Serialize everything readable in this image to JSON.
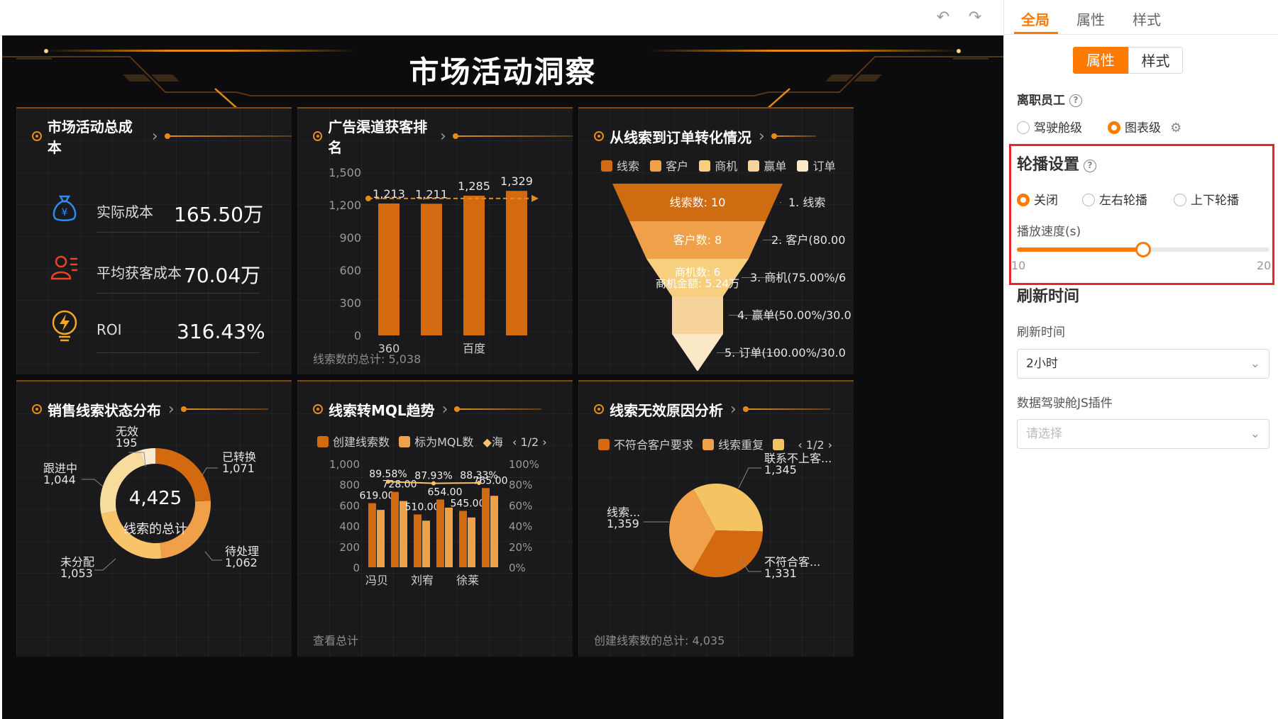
{
  "toolbar": {
    "undo_icon": "undo-icon",
    "redo_icon": "redo-icon"
  },
  "dashboard": {
    "title": "市场活动洞察",
    "panels": {
      "cost": {
        "title": "市场活动总成本",
        "items": [
          {
            "label": "实际成本",
            "value": "165.50万",
            "icon": "money-bag-icon"
          },
          {
            "label": "平均获客成本",
            "value": "70.04万",
            "icon": "user-list-icon"
          },
          {
            "label": "ROI",
            "value": "316.43%",
            "icon": "lightning-icon"
          }
        ]
      },
      "channel": {
        "title": "广告渠道获客排名",
        "footer": "线索数的总计: 5,038"
      },
      "funnel": {
        "title": "从线索到订单转化情况",
        "legend": [
          "线索",
          "客户",
          "商机",
          "赢单",
          "订单"
        ],
        "inner_labels": [
          "线索数: 10",
          "客户数: 8",
          "商机数: 6",
          "商机金额: 5.24万"
        ],
        "outer_labels": [
          "1. 线索",
          "2. 客户(80.00",
          "3. 商机(75.00%/6",
          "4. 赢单(50.00%/30.0",
          "5. 订单(100.00%/30.0"
        ]
      },
      "status": {
        "title": "销售线索状态分布",
        "center_value": "4,425",
        "center_label": "线索的总计",
        "labels": [
          {
            "name": "无效",
            "value": "195"
          },
          {
            "name": "已转换",
            "value": "1,071"
          },
          {
            "name": "跟进中",
            "value": "1,044"
          },
          {
            "name": "待处理",
            "value": "1,062"
          },
          {
            "name": "未分配",
            "value": "1,053"
          }
        ]
      },
      "mql": {
        "title": "线索转MQL趋势",
        "legend": [
          "创建线索数",
          "标为MQL数",
          "海"
        ],
        "pager": "1/2",
        "footer": "查看总计"
      },
      "invalid": {
        "title": "线索无效原因分析",
        "legend": [
          "不符合客户要求",
          "线索重复",
          ""
        ],
        "pager": "1/2",
        "labels": [
          {
            "name": "联系不上客...",
            "value": "1,345"
          },
          {
            "name": "线索...",
            "value": "1,359"
          },
          {
            "name": "不符合客...",
            "value": "1,331"
          }
        ],
        "footer": "创建线索数的总计: 4,035"
      }
    }
  },
  "chart_data": [
    {
      "type": "bar",
      "title": "广告渠道获客排名",
      "categories": [
        "360",
        "",
        "百度",
        ""
      ],
      "x_tick_labels": [
        "360",
        "百度"
      ],
      "values": [
        1213,
        1211,
        1285,
        1329
      ],
      "value_labels": [
        "1,213",
        "1,211",
        "1,285",
        "1,329"
      ],
      "y_tick_labels": [
        "0",
        "300",
        "600",
        "900",
        "1,200",
        "1,500"
      ],
      "ylim": [
        0,
        1500
      ],
      "reference_line": 1259.5,
      "colors": {
        "bar": "#d46a10",
        "ref": "#e68a1a"
      }
    },
    {
      "type": "funnel",
      "title": "从线索到订单转化情况",
      "categories": [
        "线索",
        "客户",
        "商机",
        "赢单",
        "订单"
      ],
      "values": [
        10,
        8,
        6,
        3,
        3
      ],
      "colors": [
        "#cf6c12",
        "#f0a048",
        "#f7cf7e",
        "#f5d39a",
        "#fbe8c6"
      ]
    },
    {
      "type": "pie",
      "title": "销售线索状态分布",
      "donut": true,
      "categories": [
        "已转换",
        "待处理",
        "未分配",
        "跟进中",
        "无效"
      ],
      "values": [
        1071,
        1062,
        1053,
        1044,
        195
      ],
      "colors": [
        "#d46a10",
        "#f0a048",
        "#f7c46a",
        "#f7dc9e",
        "#fbead0"
      ]
    },
    {
      "type": "bar",
      "title": "线索转MQL趋势",
      "categories": [
        "冯贝",
        "",
        "刘宥",
        "",
        "徐莱",
        ""
      ],
      "x_tick_labels": [
        "冯贝",
        "刘宥",
        "徐莱"
      ],
      "series": [
        {
          "name": "创建线索数",
          "values": [
            619,
            728,
            510,
            654,
            545,
            765
          ]
        },
        {
          "name": "标为MQL数",
          "values": [
            554,
            640,
            450,
            576,
            481,
            690
          ]
        }
      ],
      "value_labels": [
        "619.00",
        "728.00",
        "510.00",
        "654.00",
        "545.00",
        "765.00"
      ],
      "line_values_pct": [
        89.58,
        87.93,
        88.33
      ],
      "line_labels": [
        "89.58%",
        "87.93%",
        "88.33%"
      ],
      "y_tick_labels": [
        "0",
        "200",
        "400",
        "600",
        "800",
        "1,000"
      ],
      "y2_tick_labels": [
        "0%",
        "20%",
        "40%",
        "60%",
        "80%",
        "100%"
      ],
      "ylim": [
        0,
        1000
      ],
      "colors": [
        "#d46a10",
        "#f0a048",
        "#f7c46a"
      ]
    },
    {
      "type": "pie",
      "title": "线索无效原因分析",
      "categories": [
        "联系不上客户",
        "不符合客户要求",
        "线索重复"
      ],
      "values": [
        1345,
        1331,
        1359
      ],
      "colors": [
        "#f4c463",
        "#d46a10",
        "#f0a048"
      ]
    }
  ],
  "settings": {
    "tabs": [
      "全局",
      "属性",
      "样式"
    ],
    "segments": [
      "属性",
      "样式"
    ],
    "resigned": {
      "label": "离职员工",
      "options": [
        "驾驶舱级",
        "图表级"
      ],
      "selected": 1
    },
    "carousel": {
      "label": "轮播设置",
      "options": [
        "关闭",
        "左右轮播",
        "上下轮播"
      ],
      "selected": 0,
      "speed_label": "播放速度(s)",
      "speed_min": "10",
      "speed_max": "20",
      "speed_value": 15
    },
    "refresh": {
      "section": "刷新时间",
      "label": "刷新时间",
      "value": "2小时"
    },
    "plugin": {
      "label": "数据驾驶舱JS插件",
      "placeholder": "请选择"
    }
  }
}
